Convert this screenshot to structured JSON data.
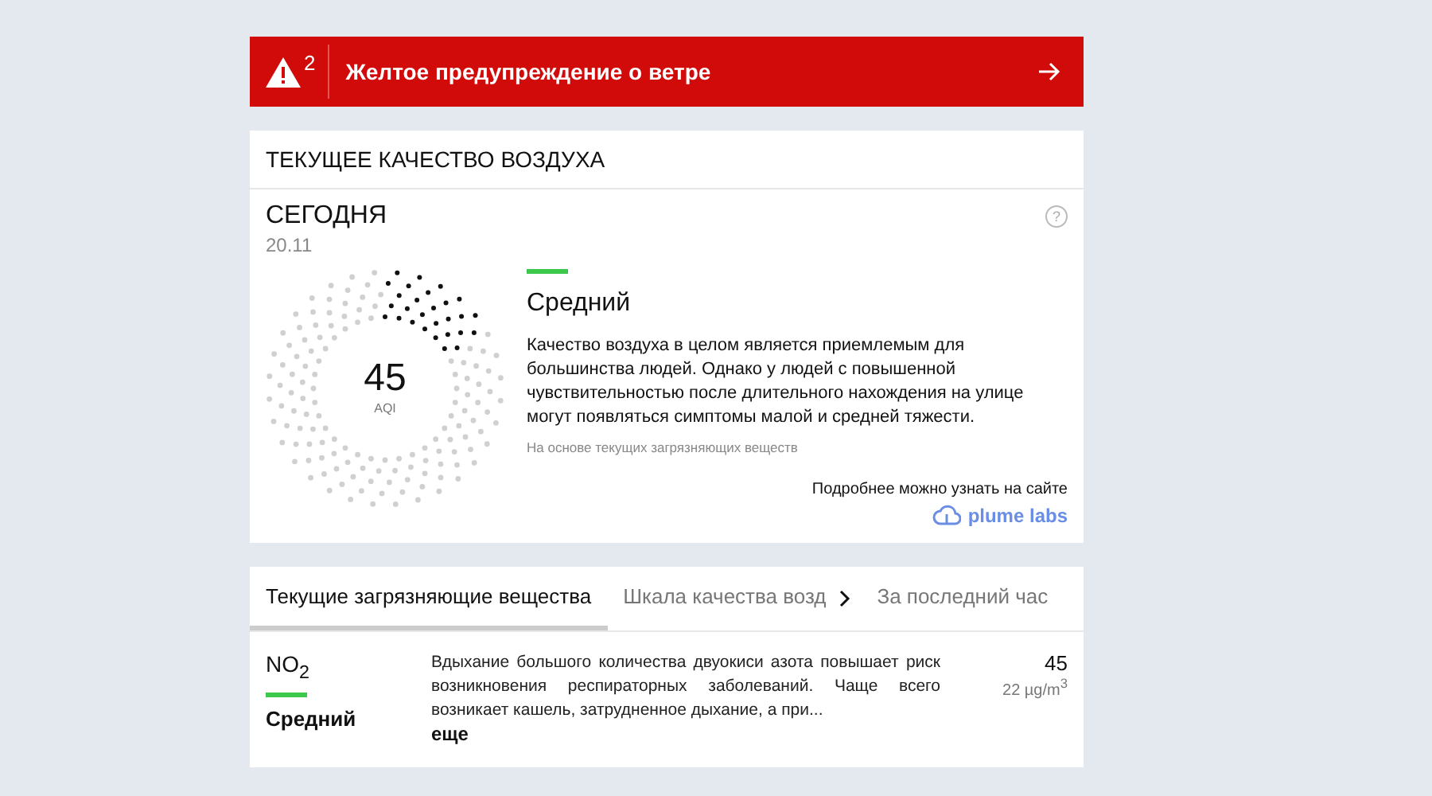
{
  "alert": {
    "count": "2",
    "text": "Желтое предупреждение о ветре"
  },
  "air_quality": {
    "title": "ТЕКУЩЕЕ КАЧЕСТВО ВОЗДУХА",
    "day": "СЕГОДНЯ",
    "date": "20.11",
    "help": "?",
    "gauge": {
      "value": "45",
      "unit": "AQI"
    },
    "rating": {
      "label": "Средний",
      "color": "#3cc84b"
    },
    "description": "Качество воздуха в целом является приемлемым для большинства людей. Однако у людей с повышенной чувствительностью после длительного нахождения на улице могут появляться симптомы малой и средней тяжести.",
    "note": "На основе текущих загрязняющих веществ",
    "more_info": "Подробнее можно узнать на сайте",
    "source": "plume labs"
  },
  "tabs": [
    {
      "label": "Текущие загрязняющие вещества",
      "selected": true
    },
    {
      "label": "Шкала качества возд",
      "selected": false
    },
    {
      "label": "За последний час",
      "selected": false
    }
  ],
  "pollutants": [
    {
      "name": "NO$_{2}$",
      "rating": "Средний",
      "color": "#3cc84b",
      "description": "Вдыхание большого количества двуокиси азота повышает риск возникновения респираторных заболеваний. Чаще всего возникает кашель, затрудненное дыхание, а при...",
      "more": "еще",
      "value": "45",
      "concentration": "22 µg/m$^{3}$"
    }
  ]
}
